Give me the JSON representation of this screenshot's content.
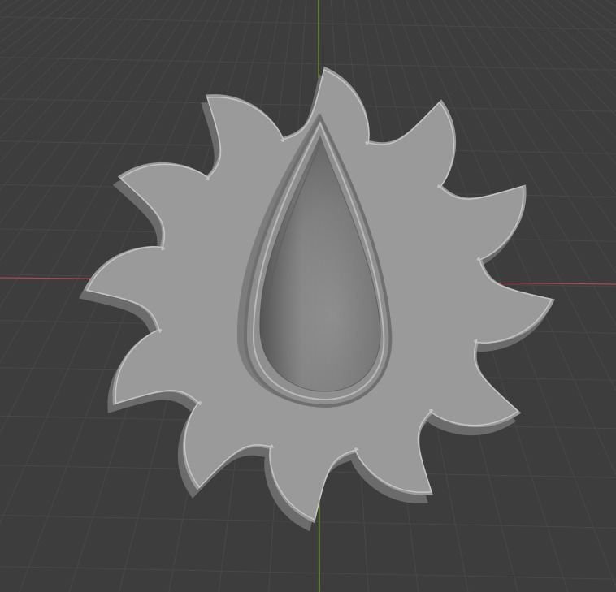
{
  "viewport": {
    "background_color": "#3d3d3d",
    "grid_color": "#484848",
    "x_axis_color": "#b5444e",
    "y_axis_color": "#7fa32a"
  },
  "object": {
    "shape": "twelve-point blade disc with teardrop relief",
    "blade_count": 12,
    "material_color": "#9a9a9a"
  }
}
